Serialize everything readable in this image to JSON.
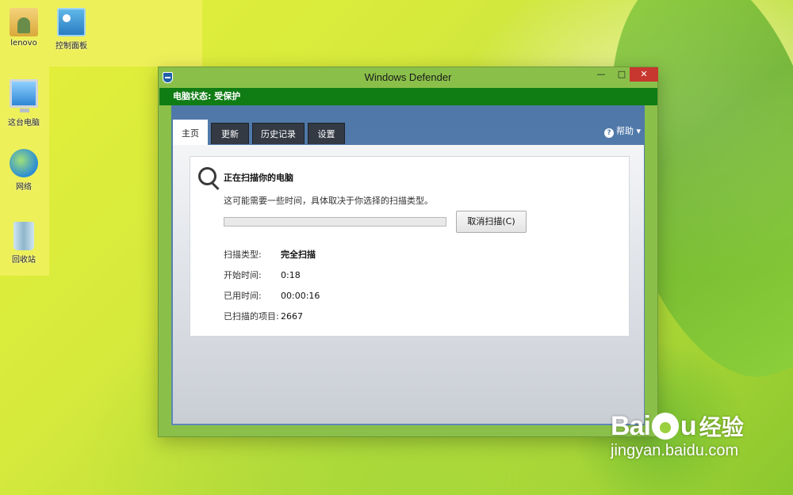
{
  "desktop": {
    "icons": [
      {
        "label": "lenovo"
      },
      {
        "label": "控制面板"
      },
      {
        "label": "这台电脑"
      },
      {
        "label": "网络"
      },
      {
        "label": "回收站"
      }
    ]
  },
  "window": {
    "title": "Windows Defender",
    "controls": {
      "minimize": "—",
      "maximize": "□",
      "close": "✕"
    },
    "status": "电脑状态: 受保护",
    "tabs": [
      {
        "label": "主页",
        "active": true
      },
      {
        "label": "更新",
        "active": false
      },
      {
        "label": "历史记录",
        "active": false
      },
      {
        "label": "设置",
        "active": false
      }
    ],
    "help": {
      "label": "帮助",
      "caret": "▾",
      "icon": "?"
    },
    "scan": {
      "title": "正在扫描你的电脑",
      "subtitle": "这可能需要一些时间，具体取决于你选择的扫描类型。",
      "progress": 0,
      "cancel_label": "取消扫描(C)",
      "details": [
        {
          "key": "扫描类型:",
          "value": "完全扫描"
        },
        {
          "key": "开始时间:",
          "value": "0:18"
        },
        {
          "key": "已用时间:",
          "value": "00:00:16"
        },
        {
          "key": "已扫描的项目:",
          "value": "2667"
        }
      ]
    }
  },
  "watermark": {
    "brand_left": "Bai",
    "brand_right": "u",
    "brand_cn": "经验",
    "url": "jingyan.baidu.com"
  },
  "colors": {
    "status_green": "#0f7c14",
    "window_frame": "#8ac04a",
    "content_blue": "#4f78a8",
    "close_red": "#c7372f"
  }
}
